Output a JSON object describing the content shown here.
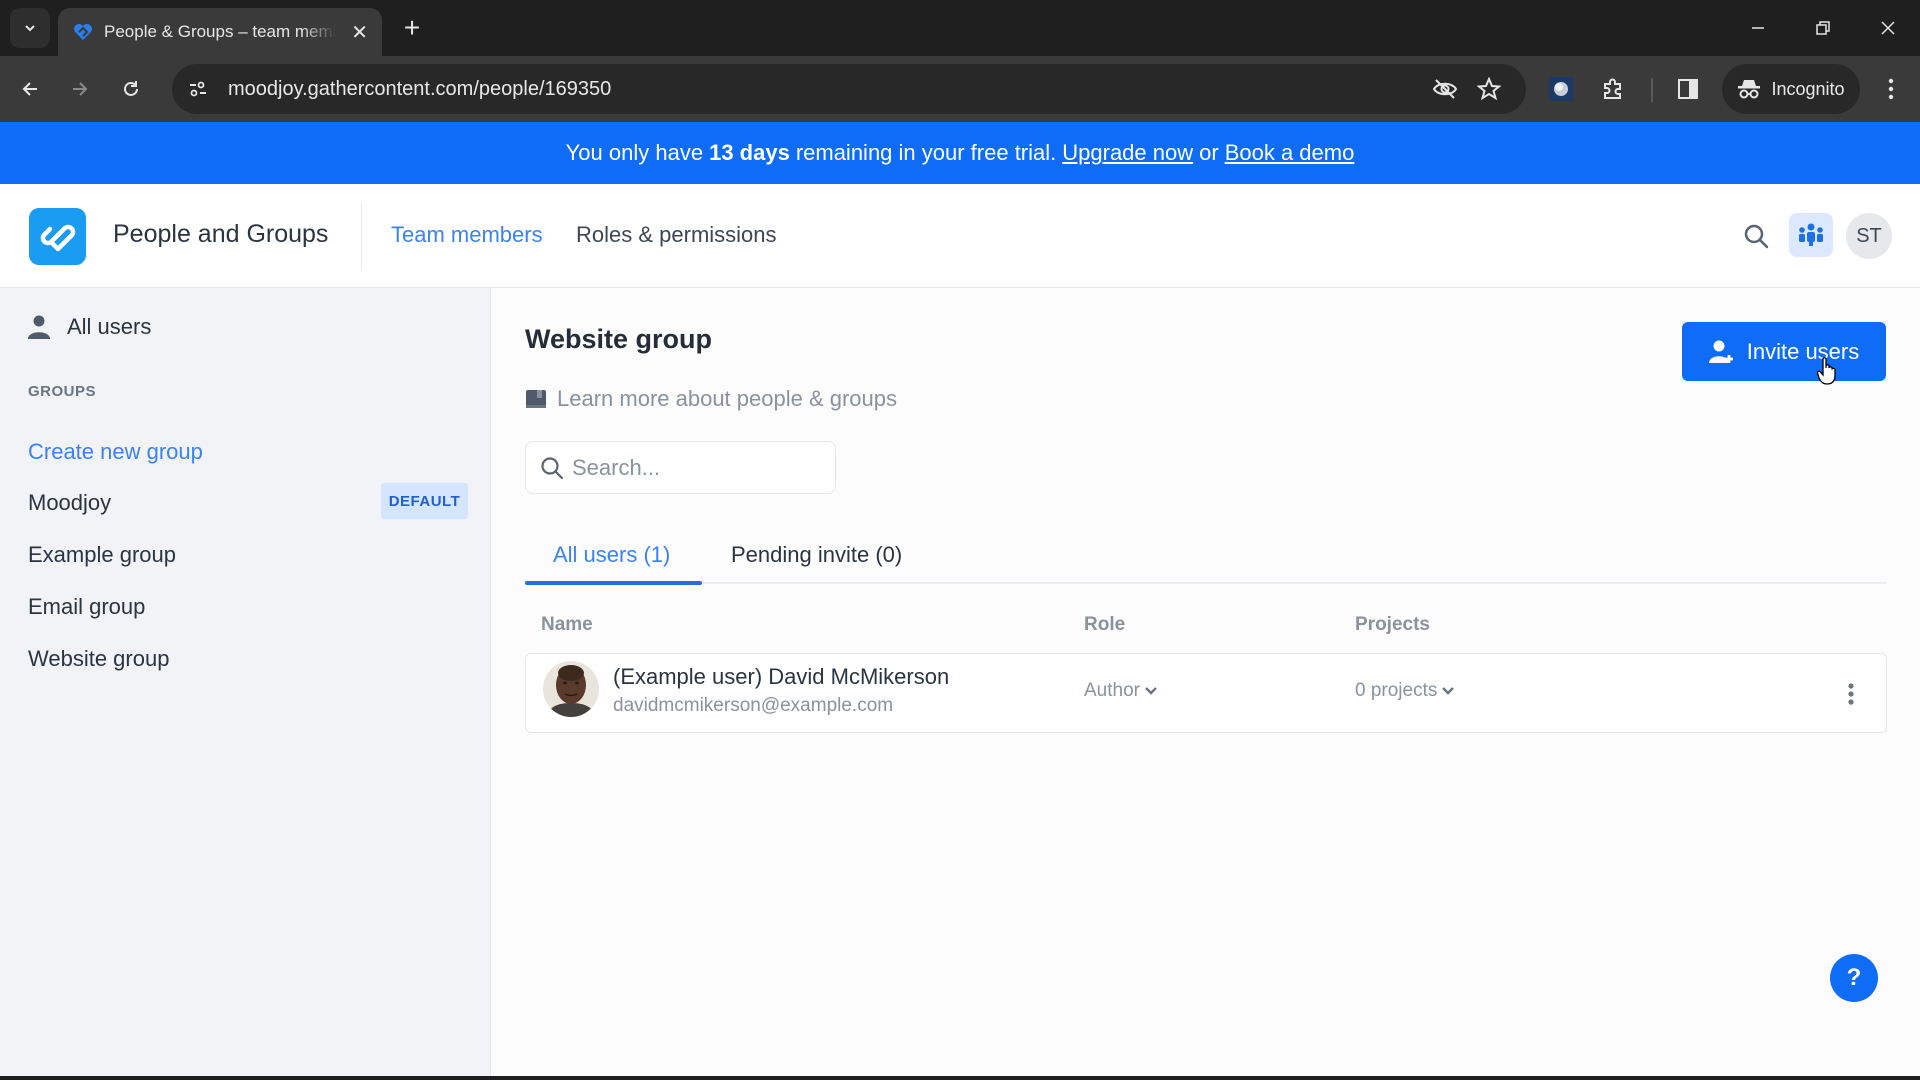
{
  "browser": {
    "tab_title": "People & Groups – team memb",
    "url": "moodjoy.gathercontent.com/people/169350",
    "incognito_label": "Incognito",
    "icons": {
      "tab_list": "chevron-down-icon",
      "tab_favicon": "gathercontent-logo-icon",
      "tab_close": "close-icon",
      "new_tab": "plus-icon",
      "back": "arrow-left-icon",
      "forward": "arrow-right-icon",
      "reload": "reload-icon",
      "site_info": "tune-icon",
      "tracking": "eye-off-icon",
      "bookmark": "star-icon",
      "extension_1": "extension-avatar-icon",
      "extensions": "puzzle-icon",
      "side_panel": "side-panel-icon",
      "incognito": "incognito-icon",
      "menu": "kebab-icon",
      "minimize": "minimize-icon",
      "restore": "restore-icon",
      "close": "close-icon"
    }
  },
  "banner": {
    "prefix": "You only have",
    "days": "13 days",
    "middle": "remaining in your free trial.",
    "upgrade_label": "Upgrade now",
    "or": "or",
    "demo_label": "Book a demo",
    "color": "#0f6cf6"
  },
  "header": {
    "title": "People and Groups",
    "nav": [
      {
        "label": "Team members",
        "active": true
      },
      {
        "label": "Roles & permissions",
        "active": false
      }
    ],
    "user_initials": "ST",
    "accent": "#3b82f6"
  },
  "sidebar": {
    "all_users_label": "All users",
    "groups_heading": "GROUPS",
    "create_label": "Create new group",
    "groups": [
      {
        "label": "Moodjoy",
        "badge": "DEFAULT"
      },
      {
        "label": "Example group"
      },
      {
        "label": "Email group"
      },
      {
        "label": "Website group"
      }
    ]
  },
  "main": {
    "title": "Website group",
    "learn_more": "Learn more about people & groups",
    "search_placeholder": "Search...",
    "search_value": "",
    "invite_label": "Invite users",
    "tabs": [
      {
        "label": "All users (1)",
        "active": true
      },
      {
        "label": "Pending invite (0)",
        "active": false
      }
    ],
    "columns": [
      "Name",
      "Role",
      "Projects"
    ],
    "users": [
      {
        "name": "(Example user) David McMikerson",
        "email": "davidmcmikerson@example.com",
        "role": "Author",
        "projects": "0 projects"
      }
    ],
    "help_label": "?"
  }
}
